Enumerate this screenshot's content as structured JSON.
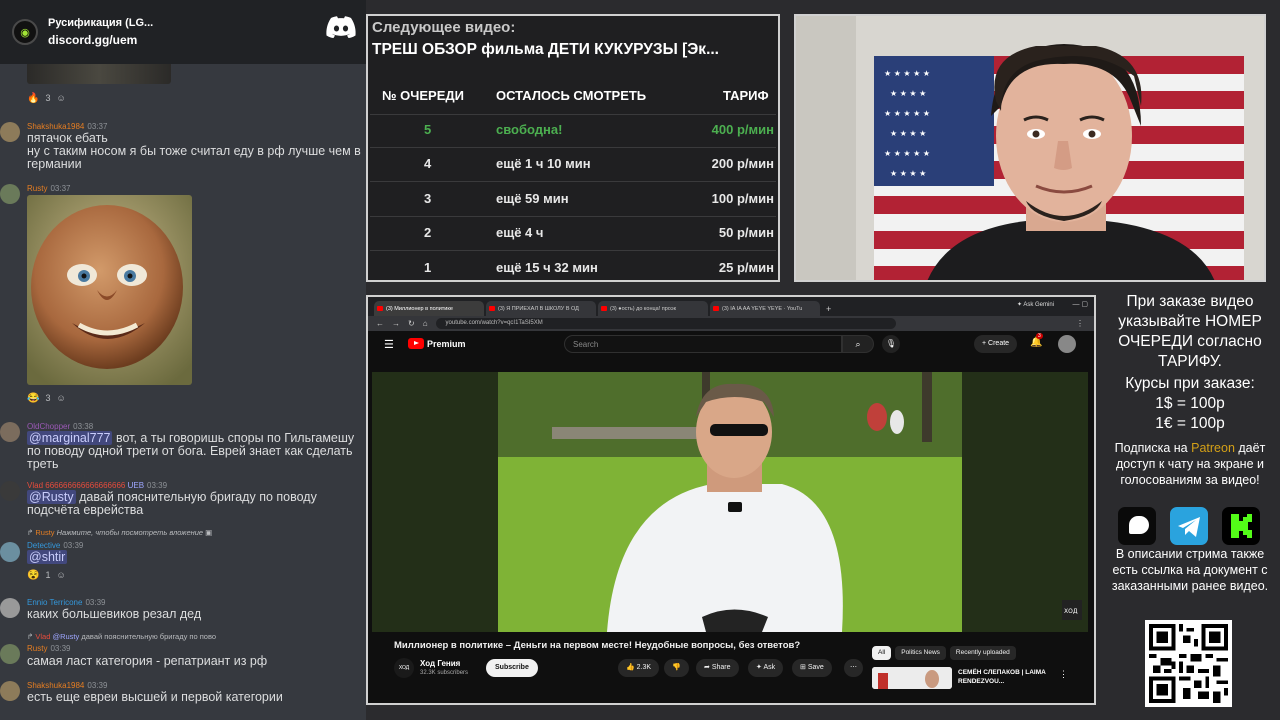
{
  "chat": {
    "server_name": "Русификация (LG...",
    "server_link": "discord.gg/uem",
    "messages": [
      {
        "user": "Shakshuka1984",
        "time": "03:37",
        "user_color": "#e67e22",
        "text": "пятачок ебать\nну с таким носом я бы тоже считал еду в рф лучше чем в германии"
      },
      {
        "user": "Rusty",
        "time": "03:37",
        "user_color": "#e67e22"
      },
      {
        "user": "OldChopper",
        "time": "03:38",
        "user_color": "#9b59b6",
        "mention": "@marginal777",
        "text": "вот, а ты говоришь споры по Гильгамешу по поводу одной трети от бога. Еврей знает как сделать треть"
      },
      {
        "user": "Vlad",
        "user_suffix": "666666666666666666",
        "tag": "UEB",
        "time": "03:39",
        "user_color": "#e74c3c",
        "mention": "@Rusty",
        "text": "давай пояснительную бригаду по поводу подсчёта еврейства"
      },
      {
        "user": "Detective",
        "time": "03:39",
        "user_color": "#3498db",
        "reply": "Нажмите, чтобы посмотреть вложение",
        "reply_user": "Rusty",
        "mention": "@shtir"
      },
      {
        "user": "Ennio Terricone",
        "time": "03:39",
        "user_color": "#3498db",
        "text": "каких большевиков резал дед"
      },
      {
        "user": "Rusty",
        "time": "03:39",
        "user_color": "#e67e22",
        "reply": "давай пояснительную бригаду по пово",
        "reply_user": "Vlad",
        "reply_mention": "@Rusty",
        "text": "самая ласт категория - репатриант из рф"
      },
      {
        "user": "Shakshuka1984",
        "time": "03:39",
        "user_color": "#e67e22",
        "text": "есть еще евреи высшей и первой категории"
      }
    ],
    "reactions": {
      "r1_count": "3",
      "r2_count": "3",
      "r3_count": "1"
    }
  },
  "queue": {
    "label": "Следующее видео:",
    "title": "ТРЕШ ОБЗОР фильма ДЕТИ КУКУРУЗЫ [Эк...",
    "headers": [
      "№ ОЧЕРЕДИ",
      "ОСТАЛОСЬ СМОТРЕТЬ",
      "ТАРИФ"
    ],
    "rows": [
      {
        "num": "5",
        "left": "свободна!",
        "price": "400 р/мин",
        "highlight": true
      },
      {
        "num": "4",
        "left": "ещё 1 ч 10 мин",
        "price": "200 р/мин",
        "highlight": false
      },
      {
        "num": "3",
        "left": "ещё 59 мин",
        "price": "100 р/мин",
        "highlight": false
      },
      {
        "num": "2",
        "left": "ещё 4 ч",
        "price": "50 р/мин",
        "highlight": false
      },
      {
        "num": "1",
        "left": "ещё 15 ч 32 мин",
        "price": "25 р/мин",
        "highlight": false
      }
    ]
  },
  "browser": {
    "tabs": [
      "(3) Миллионер в политике",
      "(3) Я ПРИЕХАЛ В ШКОЛУ В ОД",
      "(3) ●ость) до конца! проэк",
      "(3) IA IA AA YEYE YEYE · YouTu"
    ],
    "ask_gemini": "Ask Gemini",
    "url": "youtube.com/watch?v=qcI1TaSI5XM",
    "premium": "Premium",
    "search_placeholder": "Search",
    "create": "Create",
    "notif_count": "3",
    "video_title": "Миллионер в политике – Деньги на первом месте! Неудобные вопросы, без ответов?",
    "channel": "Ход Гения",
    "channel_avatar": "ХОД",
    "subs": "32.3K subscribers",
    "subscribe": "Subscribe",
    "likes": "2.3K",
    "share": "Share",
    "ask": "Ask",
    "save": "Save",
    "chips": [
      "All",
      "Politics News",
      "Recently uploaded"
    ],
    "rec_title": "СЕМЁН СЛЕПАКОВ | LAIMA RENDEZVOU...",
    "watermark": "ХОД"
  },
  "info": {
    "order_note": "При заказе видео указывайте НОМЕР ОЧЕРЕДИ согласно ТАРИФУ.",
    "rates_label": "Курсы при заказе:",
    "rate_usd": "1$ = 100р",
    "rate_eur": "1€ = 100р",
    "sub_prefix": "Подписка на",
    "patreon": "Patreon",
    "sub_suffix": "даёт доступ к чату на экране и голосованиям за видео!",
    "doc_note": "В описании стрима также есть ссылка на документ с заказанными ранее видео.",
    "patreon_color": "#d4a017",
    "social_icons": [
      "patreon-icon",
      "telegram-icon",
      "kick-icon"
    ]
  }
}
